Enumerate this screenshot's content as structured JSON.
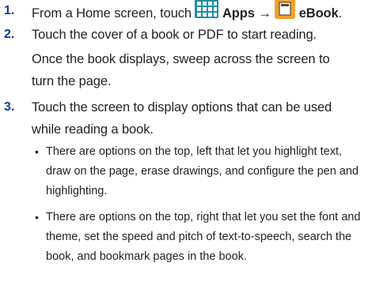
{
  "steps": [
    {
      "number": "1.",
      "text_before": "From a Home screen, touch",
      "apps_label": "Apps",
      "arrow": "→",
      "ebook_label": "eBook",
      "end": "."
    },
    {
      "number": "2.",
      "lines": [
        "Touch the cover of a book or PDF to start reading.",
        "Once the book displays, sweep across the screen to",
        "turn the page."
      ]
    },
    {
      "number": "3.",
      "lines": [
        "Touch the screen to display options that can be used",
        "while reading a book."
      ],
      "bullets": [
        {
          "lines": [
            "There are options on the top, left that let you highlight text,",
            "draw on the page, erase drawings, and configure the pen and",
            "highlighting."
          ]
        },
        {
          "lines": [
            "There are options on the top, right that let you set the font and",
            "theme, set the speed and pitch of text-to-speech, search the",
            "book, and bookmark pages in the book."
          ]
        }
      ]
    }
  ],
  "icons": {
    "apps": "apps-grid-icon",
    "ebook": "ebook-icon"
  },
  "colors": {
    "step_number": "#0d3b8f",
    "apps_icon": "#1f8fa6",
    "ebook_icon": "#f0a030"
  }
}
